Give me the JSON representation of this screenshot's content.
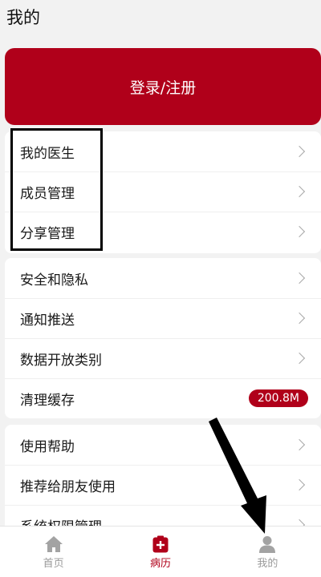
{
  "header": {
    "title": "我的"
  },
  "login": {
    "label": "登录/注册"
  },
  "groups": [
    {
      "items": [
        {
          "label": "我的医生"
        },
        {
          "label": "成员管理"
        },
        {
          "label": "分享管理"
        }
      ]
    },
    {
      "items": [
        {
          "label": "安全和隐私"
        },
        {
          "label": "通知推送"
        },
        {
          "label": "数据开放类别"
        },
        {
          "label": "清理缓存",
          "badge": "200.8M"
        }
      ]
    },
    {
      "items": [
        {
          "label": "使用帮助"
        },
        {
          "label": "推荐给朋友使用"
        },
        {
          "label": "系统权限管理"
        }
      ]
    }
  ],
  "nav": [
    {
      "label": "首页",
      "icon": "home-icon"
    },
    {
      "label": "病历",
      "icon": "medical-record-icon",
      "active": true
    },
    {
      "label": "我的",
      "icon": "person-icon"
    }
  ],
  "colors": {
    "accent": "#b0001a",
    "background": "#f2f2f2",
    "inactive": "#9a9a9a"
  }
}
